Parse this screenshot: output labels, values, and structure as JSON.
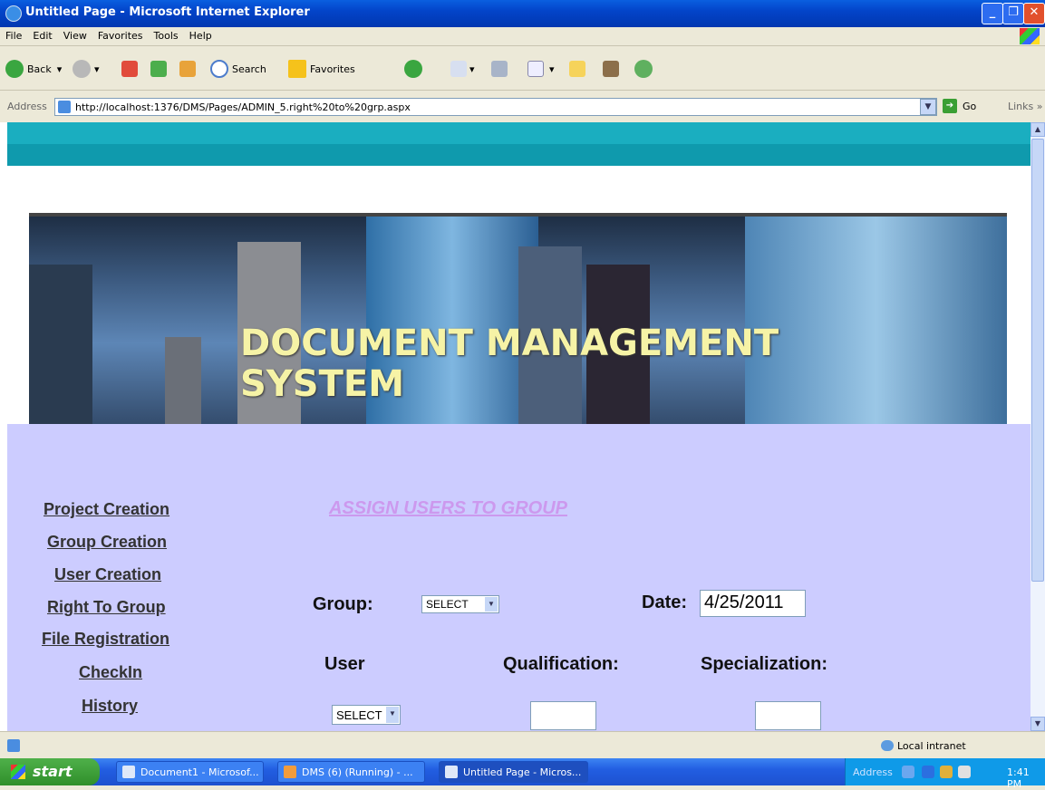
{
  "window": {
    "title": "Untitled Page - Microsoft Internet Explorer"
  },
  "menu": [
    "File",
    "Edit",
    "View",
    "Favorites",
    "Tools",
    "Help"
  ],
  "toolbar": {
    "back": "Back",
    "search": "Search",
    "favorites": "Favorites"
  },
  "address": {
    "label": "Address",
    "url": "http://localhost:1376/DMS/Pages/ADMIN_5.right%20to%20grp.aspx",
    "go": "Go",
    "links": "Links"
  },
  "banner": {
    "line1": "DOCUMENT MANAGEMENT",
    "line2": "SYSTEM"
  },
  "nav": [
    "Project Creation",
    "Group Creation",
    "User Creation",
    "Right To Group",
    "File Registration",
    "CheckIn",
    "History"
  ],
  "form": {
    "heading": "ASSIGN USERS TO GROUP",
    "group_label": "Group:",
    "group_select": "SELECT",
    "date_label": "Date:",
    "date_value": "4/25/2011",
    "user_label": "User",
    "qualification_label": "Qualification:",
    "specialization_label": "Specialization:",
    "user_select": "SELECT"
  },
  "status": {
    "zone": "Local intranet"
  },
  "taskbar": {
    "start": "start",
    "tasks": [
      "Document1 - Microsof...",
      "DMS (6) (Running) - ...",
      "Untitled Page - Micros..."
    ],
    "tray_address": "Address",
    "clock": "1:41 PM"
  }
}
